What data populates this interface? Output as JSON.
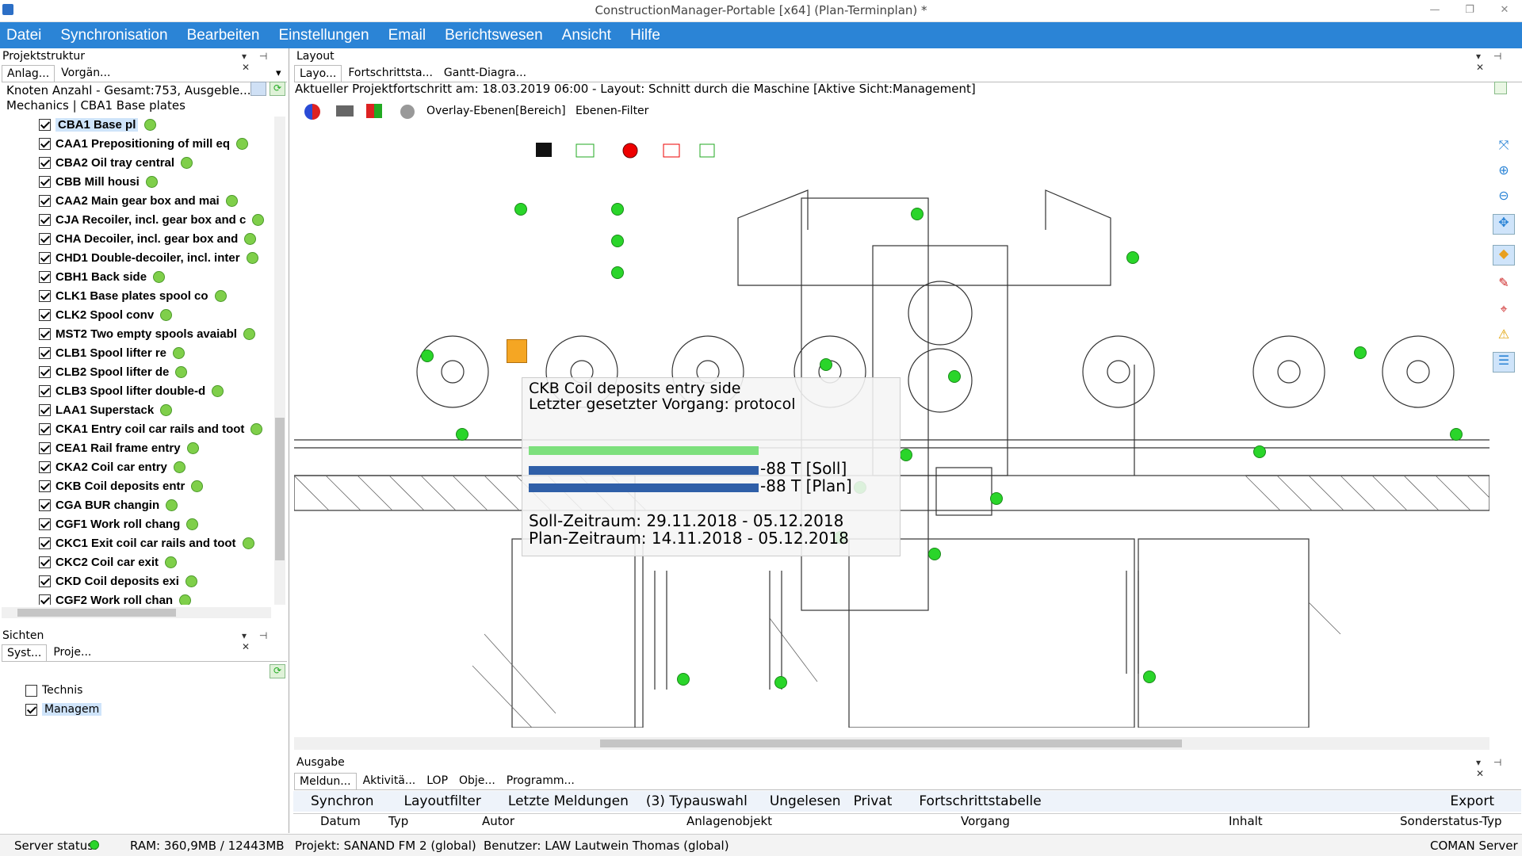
{
  "window": {
    "title": "ConstructionManager-Portable [x64] (Plan-Terminplan) *"
  },
  "menu": [
    "Datei",
    "Synchronisation",
    "Bearbeiten",
    "Einstellungen",
    "Email",
    "Berichtswesen",
    "Ansicht",
    "Hilfe"
  ],
  "projektstruktur": {
    "title": "Projektstruktur",
    "tabs": [
      "Anlag...",
      "Vorgän..."
    ],
    "info": "Knoten Anzahl - Gesamt:753, Ausgeble...",
    "breadcrumb": "Mechanics | CBA1 Base plates",
    "items": [
      {
        "label": "CBA1 Base pl",
        "selected": true
      },
      {
        "label": "CAA1 Prepositioning of mill eq"
      },
      {
        "label": "CBA2 Oil tray central"
      },
      {
        "label": "CBB Mill housi"
      },
      {
        "label": "CAA2 Main gear box and mai"
      },
      {
        "label": "CJA Recoiler, incl. gear box and c"
      },
      {
        "label": "CHA Decoiler, incl. gear box and"
      },
      {
        "label": "CHD1 Double-decoiler, incl. inter"
      },
      {
        "label": "CBH1 Back side"
      },
      {
        "label": "CLK1 Base plates spool co"
      },
      {
        "label": "CLK2 Spool conv"
      },
      {
        "label": "MST2 Two empty spools avaiabl"
      },
      {
        "label": "CLB1 Spool lifter re"
      },
      {
        "label": "CLB2 Spool lifter de"
      },
      {
        "label": "CLB3 Spool lifter double-d"
      },
      {
        "label": "LAA1 Superstack"
      },
      {
        "label": "CKA1 Entry coil car rails and toot"
      },
      {
        "label": "CEA1 Rail frame entry"
      },
      {
        "label": "CKA2 Coil car entry"
      },
      {
        "label": "CKB Coil deposits entr"
      },
      {
        "label": "CGA BUR changin"
      },
      {
        "label": "CGF1 Work roll chang"
      },
      {
        "label": "CKC1 Exit coil car rails and toot"
      },
      {
        "label": "CKC2 Coil car exit"
      },
      {
        "label": "CKD Coil deposits exi"
      },
      {
        "label": "CGF2 Work roll chan"
      }
    ]
  },
  "sichten": {
    "title": "Sichten",
    "tabs": [
      "Syst...",
      "Proje..."
    ],
    "items": [
      {
        "label": "Technis",
        "checked": false
      },
      {
        "label": "Managem",
        "checked": true
      }
    ]
  },
  "layout": {
    "title": "Layout",
    "tabs": [
      "Layo...",
      "Fortschrittsta...",
      "Gantt-Diagra..."
    ],
    "progress_line": "Aktueller Projektfortschritt am: 18.03.2019 06:00 - Layout: Schnitt durch die Maschine [Aktive Sicht:Management]",
    "overlay_label": "Overlay-Ebenen[Bereich]",
    "filter_label": "Ebenen-Filter"
  },
  "tooltip": {
    "title": "CKB Coil deposits entry side",
    "last_step": "Letzter gesetzter Vorgang: protocol",
    "soll_value": "-88 T [Soll]",
    "plan_value": "-88 T [Plan]",
    "soll_range": "Soll-Zeitraum: 29.11.2018 - 05.12.2018",
    "plan_range": "Plan-Zeitraum: 14.11.2018 - 05.12.2018",
    "progress": 1.0
  },
  "output": {
    "title": "Ausgabe",
    "tabs": [
      "Meldun...",
      "Aktivitä...",
      "LOP",
      "Obje...",
      "Programm..."
    ],
    "toolbar": [
      "Synchron",
      "Layoutfilter",
      "Letzte Meldungen",
      "(3) Typauswahl",
      "Ungelesen",
      "Privat",
      "Fortschrittstabelle",
      "Export"
    ],
    "columns": [
      "Datum",
      "Typ",
      "Autor",
      "Anlagenobjekt",
      "Vorgang",
      "Inhalt",
      "Sonderstatus-Typ"
    ]
  },
  "status": {
    "server": "Server status:",
    "ram": "RAM: 360,9MB / 12443MB",
    "projekt": "Projekt: SANAND FM 2 (global)",
    "benutzer": "Benutzer: LAW Lautwein Thomas (global)",
    "server_name": "COMAN Server"
  },
  "colors": {
    "accent": "#2b84d6",
    "status_green": "#2ad52a",
    "bar_blue": "#2f5fa8",
    "bar_green": "#7de07d"
  }
}
